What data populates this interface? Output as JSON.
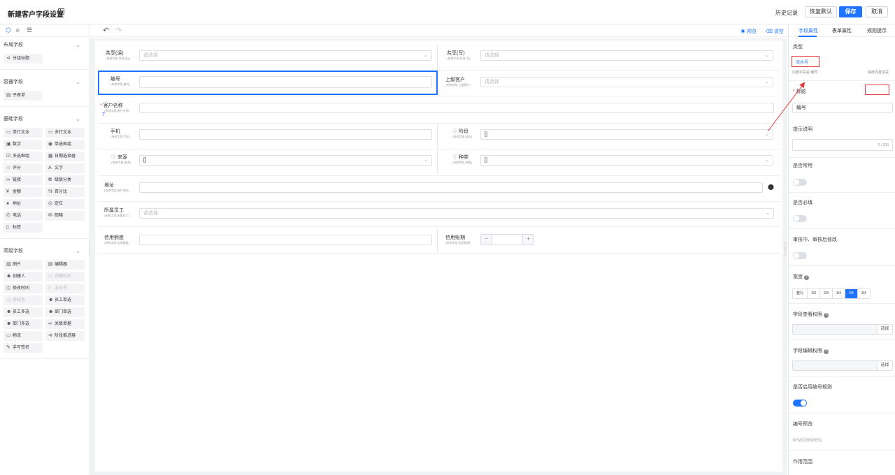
{
  "header": {
    "title": "新建客户字段设置",
    "history": "历史记录",
    "restore_default": "恢复默认",
    "save": "保存",
    "cancel": "取消"
  },
  "left_panel": {
    "sections": [
      {
        "title": "布局字段",
        "items": [
          {
            "icon": "⊲",
            "label": "分组标题",
            "disabled": false
          }
        ]
      },
      {
        "title": "容器字段",
        "items": [
          {
            "icon": "▤",
            "label": "子表单",
            "disabled": false
          }
        ]
      },
      {
        "title": "基础字段",
        "items": [
          {
            "icon": "▭",
            "label": "单行文本",
            "disabled": false
          },
          {
            "icon": "▭",
            "label": "多行文本",
            "disabled": false
          },
          {
            "icon": "▣",
            "label": "数字",
            "disabled": false
          },
          {
            "icon": "◉",
            "label": "单选框组",
            "disabled": false
          },
          {
            "icon": "☑",
            "label": "多选框组",
            "disabled": false
          },
          {
            "icon": "▦",
            "label": "日期选择器",
            "disabled": false
          },
          {
            "icon": "☆",
            "label": "评分",
            "disabled": false
          },
          {
            "icon": "A",
            "label": "文字",
            "disabled": false
          },
          {
            "icon": "∞",
            "label": "链接",
            "disabled": false
          },
          {
            "icon": "⧉",
            "label": "级联分类",
            "disabled": false
          },
          {
            "icon": "¥",
            "label": "金额",
            "disabled": false
          },
          {
            "icon": "%",
            "label": "百分比",
            "disabled": false
          },
          {
            "icon": "●",
            "label": "地址",
            "disabled": false
          },
          {
            "icon": "◎",
            "label": "定位",
            "disabled": false
          },
          {
            "icon": "✆",
            "label": "电话",
            "disabled": false
          },
          {
            "icon": "✉",
            "label": "邮箱",
            "disabled": false
          },
          {
            "icon": "▯",
            "label": "标签",
            "disabled": false
          }
        ]
      },
      {
        "title": "高级字段",
        "items": [
          {
            "icon": "▨",
            "label": "图片",
            "disabled": false
          },
          {
            "icon": "▤",
            "label": "编辑器",
            "disabled": false
          },
          {
            "icon": "☻",
            "label": "创建人",
            "disabled": false
          },
          {
            "icon": "◷",
            "label": "创建时间",
            "disabled": true
          },
          {
            "icon": "◷",
            "label": "修改时间",
            "disabled": false
          },
          {
            "icon": "#",
            "label": "流水号",
            "disabled": true
          },
          {
            "icon": "◷",
            "label": "审核者",
            "disabled": true
          },
          {
            "icon": "☻",
            "label": "员工单选",
            "disabled": false
          },
          {
            "icon": "☻",
            "label": "员工多选",
            "disabled": false
          },
          {
            "icon": "☻",
            "label": "部门单选",
            "disabled": false
          },
          {
            "icon": "☻",
            "label": "部门多选",
            "disabled": false
          },
          {
            "icon": "∞",
            "label": "关联单据",
            "disabled": false
          },
          {
            "icon": "▭",
            "label": "物流",
            "disabled": false
          },
          {
            "icon": "⊲",
            "label": "阶段推进器",
            "disabled": false
          },
          {
            "icon": "✎",
            "label": "手写签名",
            "disabled": false
          }
        ]
      }
    ]
  },
  "toolbar": {
    "preview": "预览",
    "clear": "清空"
  },
  "form": {
    "share_read": {
      "label": "共享(读)",
      "sub": "(系统字段-共享(读))",
      "placeholder": "请选择"
    },
    "share_write": {
      "label": "共享(写)",
      "sub": "(系统字段-共享(写))",
      "placeholder": "请选择"
    },
    "number": {
      "label": "编号",
      "sub": "(系统字段-编号)"
    },
    "parent_customer": {
      "label": "上级客户",
      "sub": "(系统字段-上级客户)",
      "placeholder": "请选择"
    },
    "customer_name": {
      "label": "客户名称",
      "sub": "(系统字段-客户名称)",
      "required": "*",
      "type_mark": "T"
    },
    "phone": {
      "label": "手机",
      "sub": "(系统字段-手机)"
    },
    "stage": {
      "label": "阶段",
      "sub": "(系统字段-阶段)",
      "value": "[]"
    },
    "source": {
      "label": "来源",
      "sub": "(系统字段-来源)",
      "value": "[]"
    },
    "category": {
      "label": "种类",
      "sub": "(系统字段-种类)",
      "value": "[]"
    },
    "address": {
      "label": "地址",
      "sub": "(系统字段-客户地址)"
    },
    "staff": {
      "label": "所属员工",
      "sub": "(系统字段-所属员工)",
      "placeholder": "请选择"
    },
    "credit_limit": {
      "label": "信用额度",
      "sub": "(系统字段-信用额度)"
    },
    "credit_period": {
      "label": "信用账期",
      "sub": "(系统字段-信用账期)",
      "minus": "−",
      "plus": "+"
    }
  },
  "right_panel": {
    "tabs": [
      "字段属性",
      "表单属性",
      "规则提示"
    ],
    "type_label": "类型",
    "type_value": "流水号",
    "builtin_name": "内置字段名:编号",
    "builtin_tag": "系统内置字段",
    "title_label": "标题",
    "title_required": "*",
    "title_value": "编号",
    "hint_label": "提示说明",
    "hint_counter": "0 / 200",
    "common_label": "是否常用",
    "required_label": "是否必填",
    "audit_label": "审核中、审核后修改",
    "width_label": "宽度",
    "widths": [
      "整行",
      "1/3",
      "2/3",
      "1/4",
      "2/4",
      "3/4"
    ],
    "width_selected": "2/4",
    "view_perm_label": "字段查看权限",
    "edit_perm_label": "字段编辑权限",
    "select_btn": "选择",
    "enable_rule_label": "是否启用编号规则",
    "enable_rule_on": true,
    "preview_label": "编号预览",
    "preview_value": "KH2023090631",
    "scope_label": "作用范围"
  }
}
